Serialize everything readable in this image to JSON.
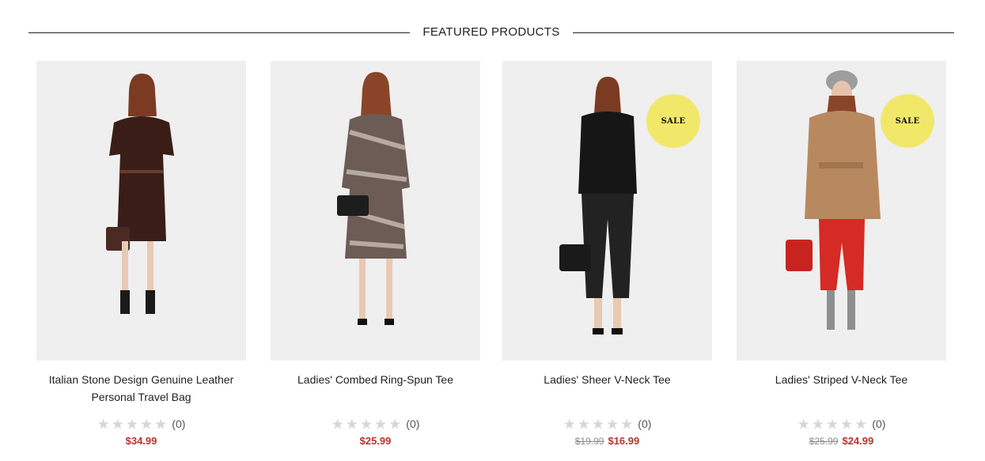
{
  "section": {
    "title": "FEATURED PRODUCTS"
  },
  "colors": {
    "price": "#b8342e",
    "sale_badge": "#f1e86a",
    "star_empty": "#d6d6d6"
  },
  "products": [
    {
      "name": "Italian Stone Design Genuine Leather Personal Travel Bag",
      "stars": "★★★★★",
      "reviews": "(0)",
      "old_price": "",
      "price": "$34.99",
      "badge": ""
    },
    {
      "name": "Ladies' Combed Ring-Spun Tee",
      "stars": "★★★★★",
      "reviews": "(0)",
      "old_price": "",
      "price": "$25.99",
      "badge": ""
    },
    {
      "name": "Ladies' Sheer V-Neck Tee",
      "stars": "★★★★★",
      "reviews": "(0)",
      "old_price": "$19.99",
      "price": "$16.99",
      "badge": "SALE"
    },
    {
      "name": "Ladies' Striped V-Neck Tee",
      "stars": "★★★★★",
      "reviews": "(0)",
      "old_price": "$25.99",
      "price": "$24.99",
      "badge": "SALE"
    }
  ]
}
